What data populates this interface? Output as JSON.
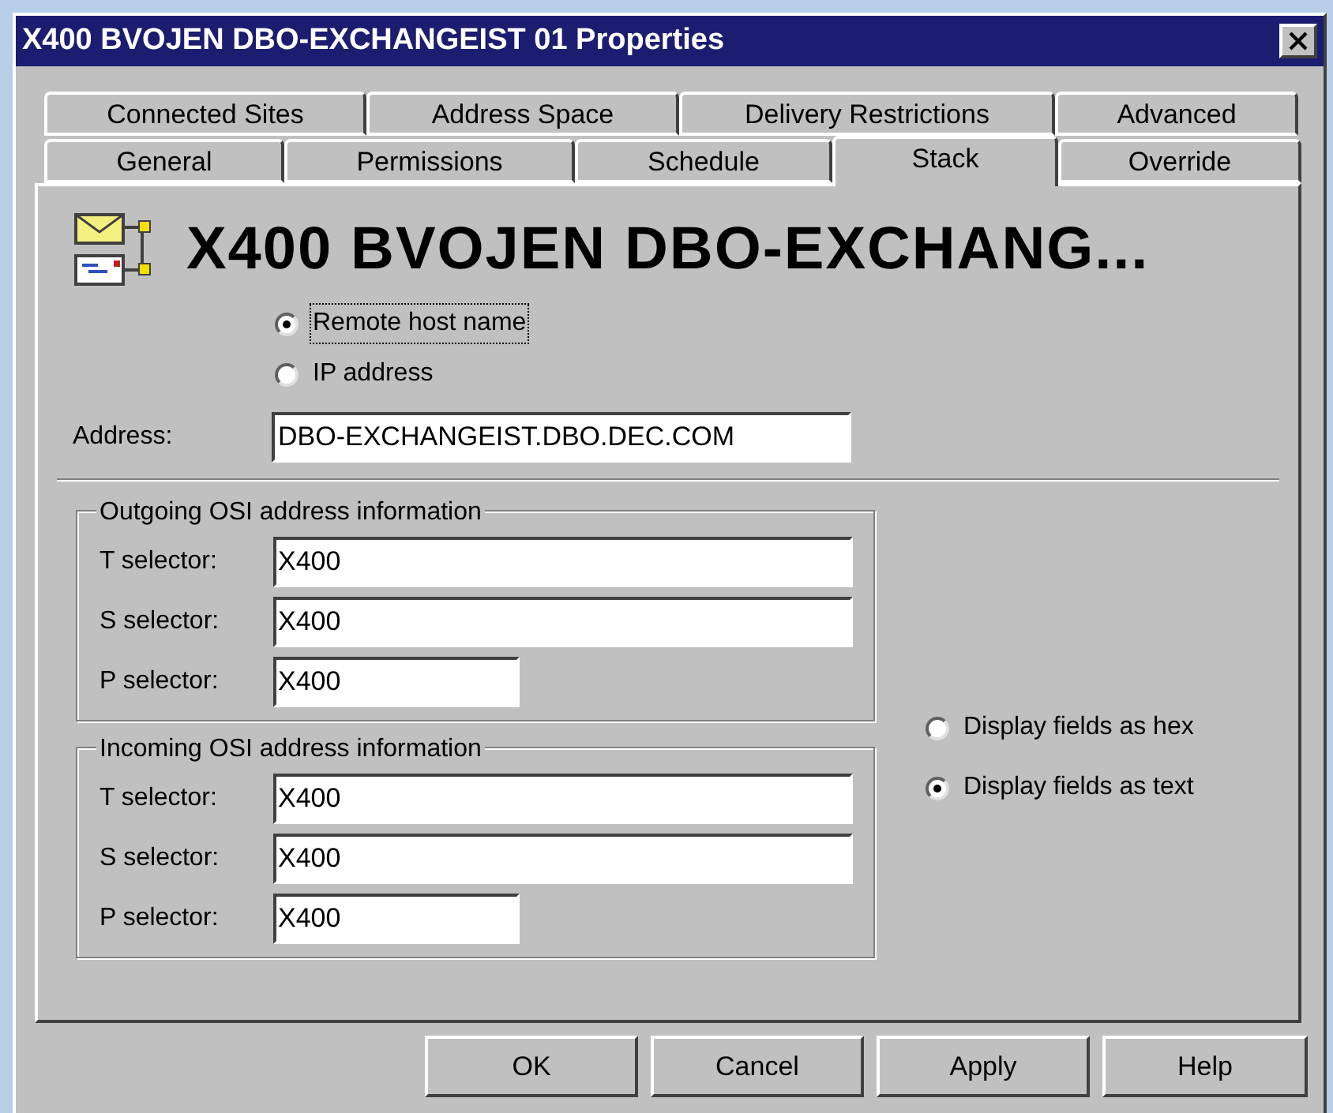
{
  "window": {
    "title": "X400 BVOJEN DBO-EXCHANGEIST 01 Properties"
  },
  "tab_rows": [
    {
      "tabs": [
        {
          "label": "Connected Sites",
          "selected": false
        },
        {
          "label": "Address Space",
          "selected": false
        },
        {
          "label": "Delivery Restrictions",
          "selected": false
        },
        {
          "label": "Advanced",
          "selected": false
        }
      ]
    },
    {
      "tabs": [
        {
          "label": "General",
          "selected": false
        },
        {
          "label": "Permissions",
          "selected": false
        },
        {
          "label": "Schedule",
          "selected": false
        },
        {
          "label": "Stack",
          "selected": true
        },
        {
          "label": "Override",
          "selected": false
        }
      ]
    }
  ],
  "heading": "X400 BVOJEN DBO-EXCHANG...",
  "address_type": [
    {
      "label": "Remote host name",
      "selected": true,
      "focused": true
    },
    {
      "label": "IP address",
      "selected": false,
      "focused": false
    }
  ],
  "address": {
    "label": "Address:",
    "value": "DBO-EXCHANGEIST.DBO.DEC.COM"
  },
  "groups": [
    {
      "title": "Outgoing OSI address information",
      "fields": [
        {
          "label": "T selector:",
          "value": "X400",
          "kind": "wide"
        },
        {
          "label": "S selector:",
          "value": "X400",
          "kind": "wide"
        },
        {
          "label": "P selector:",
          "value": "X400",
          "kind": "short"
        }
      ]
    },
    {
      "title": "Incoming OSI address information",
      "fields": [
        {
          "label": "T selector:",
          "value": "X400",
          "kind": "wide"
        },
        {
          "label": "S selector:",
          "value": "X400",
          "kind": "wide"
        },
        {
          "label": "P selector:",
          "value": "X400",
          "kind": "short"
        }
      ]
    }
  ],
  "display_mode": [
    {
      "label": "Display fields as hex",
      "selected": false
    },
    {
      "label": "Display fields as text",
      "selected": true
    }
  ],
  "buttons": [
    "OK",
    "Cancel",
    "Apply",
    "Help"
  ]
}
